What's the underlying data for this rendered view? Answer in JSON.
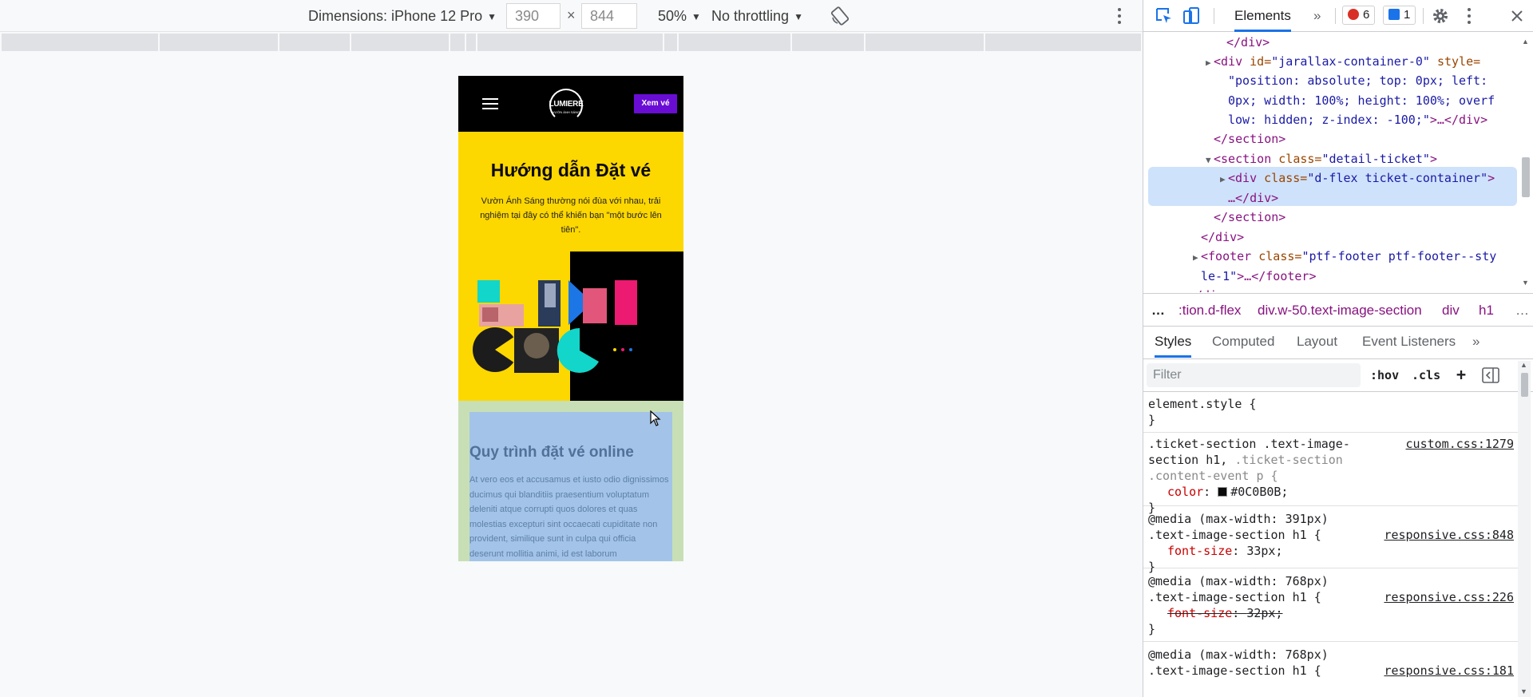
{
  "device_toolbar": {
    "dimensions_label": "Dimensions: iPhone 12 Pro",
    "width": "390",
    "times": "×",
    "height": "844",
    "zoom": "50%",
    "throttling": "No throttling"
  },
  "mobile": {
    "logo_text": "LUMIERE",
    "logo_sub": "VƯỜN ÁNH SÁNG",
    "cta_label": "Xem vé",
    "hero_title": "Hướng dẫn Đặt vé",
    "hero_desc": "Vườn Ánh Sáng thường nói đùa với nhau, trải nghiệm tại đây có thể khiến bạn \"một bước lên tiên\".",
    "section_title": "Quy trình đặt vé online",
    "section_body": "At vero eos et accusamus et iusto odio dignissimos ducimus qui blanditiis praesentium voluptatum deleniti atque corrupti quos dolores et quas molestias excepturi sint occaecati cupiditate non provident, similique sunt in culpa qui officia deserunt mollitia animi, id est laborum"
  },
  "devtools": {
    "tabs": {
      "elements": "Elements",
      "more": "»"
    },
    "errors": "6",
    "messages": "1",
    "dom": {
      "line1": "</div>",
      "line2_tag": "<div ",
      "line2_attr1": "id=",
      "line2_val1": "\"jarallax-container-0\"",
      "line2_attr2": " style=",
      "line3": "\"position: absolute; top: 0px; left:",
      "line4": "0px; width: 100%; height: 100%; overf",
      "line5_val": "low: hidden; z-index: -100;\"",
      "line5_rest": ">…</div>",
      "line6": "</section>",
      "line7_tag": "<section ",
      "line7_attr": "class=",
      "line7_val": "\"detail-ticket\"",
      "line7_end": ">",
      "line8_tag": "<div ",
      "line8_attr": "class=",
      "line8_val": "\"d-flex ticket-container\"",
      "line8_end": ">",
      "line9": "…</div>",
      "line10": "</section>",
      "line11": "</div>",
      "line12_tag": "<footer ",
      "line12_attr": "class=",
      "line12_val": "\"ptf-footer ptf-footer--sty",
      "line13_val": "le-1\"",
      "line13_rest": ">…</footer>",
      "line14": "</div>"
    },
    "breadcrumbs": [
      "…",
      ":tion.d-flex",
      "div.w-50.text-image-section",
      "div",
      "h1",
      "…"
    ],
    "subtabs": [
      "Styles",
      "Computed",
      "Layout",
      "Event Listeners",
      "»"
    ],
    "filter_placeholder": "Filter",
    "hov": ":hov",
    "cls": ".cls",
    "plus": "+",
    "rules": {
      "r1_sel": "element.style {",
      "close": "}",
      "r2_sel_a": ".ticket-section .text-image-",
      "r2_sel_b": "section h1,",
      "r2_sel_c": ".ticket-section",
      "r2_sel_d": ".content-event p {",
      "r2_src": "custom.css:1279",
      "r2_prop": "color",
      "r2_val": "#0C0B0B;",
      "r3_media": "@media (max-width: 391px)",
      "r3_sel": ".text-image-section h1 {",
      "r3_src": "responsive.css:848",
      "r3_prop": "font-size",
      "r3_val": "33px;",
      "r4_media": "@media (max-width: 768px)",
      "r4_sel": ".text-image-section h1 {",
      "r4_src": "responsive.css:226",
      "r4_prop": "font-size",
      "r4_val": "32px;",
      "r5_media": "@media (max-width: 768px)",
      "r5_sel": ".text-image-section h1 {",
      "r5_src": "responsive.css:181"
    },
    "colon": ": "
  }
}
